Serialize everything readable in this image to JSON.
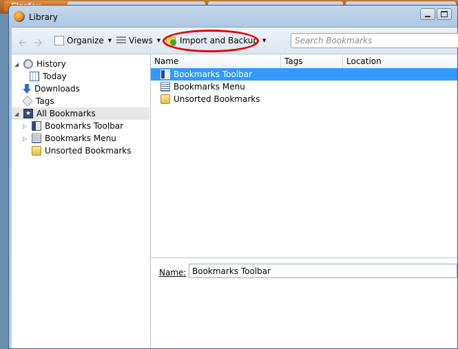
{
  "background": {
    "firefox_tab_label": "Firefox"
  },
  "window": {
    "title": "Library"
  },
  "toolbar": {
    "organize_label": "Organize",
    "views_label": "Views",
    "import_backup_label": "Import and Backup",
    "search_placeholder": "Search Bookmarks",
    "highlight_color": "#e00000"
  },
  "sidebar": {
    "items": [
      {
        "label": "History",
        "icon": "history-icon"
      },
      {
        "label": "Today",
        "icon": "calendar-icon"
      },
      {
        "label": "Downloads",
        "icon": "downloads-icon"
      },
      {
        "label": "Tags",
        "icon": "tag-icon"
      },
      {
        "label": "All Bookmarks",
        "icon": "all-bookmarks-icon"
      },
      {
        "label": "Bookmarks Toolbar",
        "icon": "bookmarks-toolbar-icon"
      },
      {
        "label": "Bookmarks Menu",
        "icon": "bookmarks-menu-icon"
      },
      {
        "label": "Unsorted Bookmarks",
        "icon": "unsorted-bookmarks-icon"
      }
    ]
  },
  "list": {
    "columns": [
      "Name",
      "Tags",
      "Location"
    ],
    "rows": [
      {
        "name": "Bookmarks Toolbar",
        "selected": true
      },
      {
        "name": "Bookmarks Menu",
        "selected": false
      },
      {
        "name": "Unsorted Bookmarks",
        "selected": false
      }
    ]
  },
  "details": {
    "name_label": "Name:",
    "name_value": "Bookmarks Toolbar"
  },
  "colors": {
    "selection": "#3399ff"
  }
}
